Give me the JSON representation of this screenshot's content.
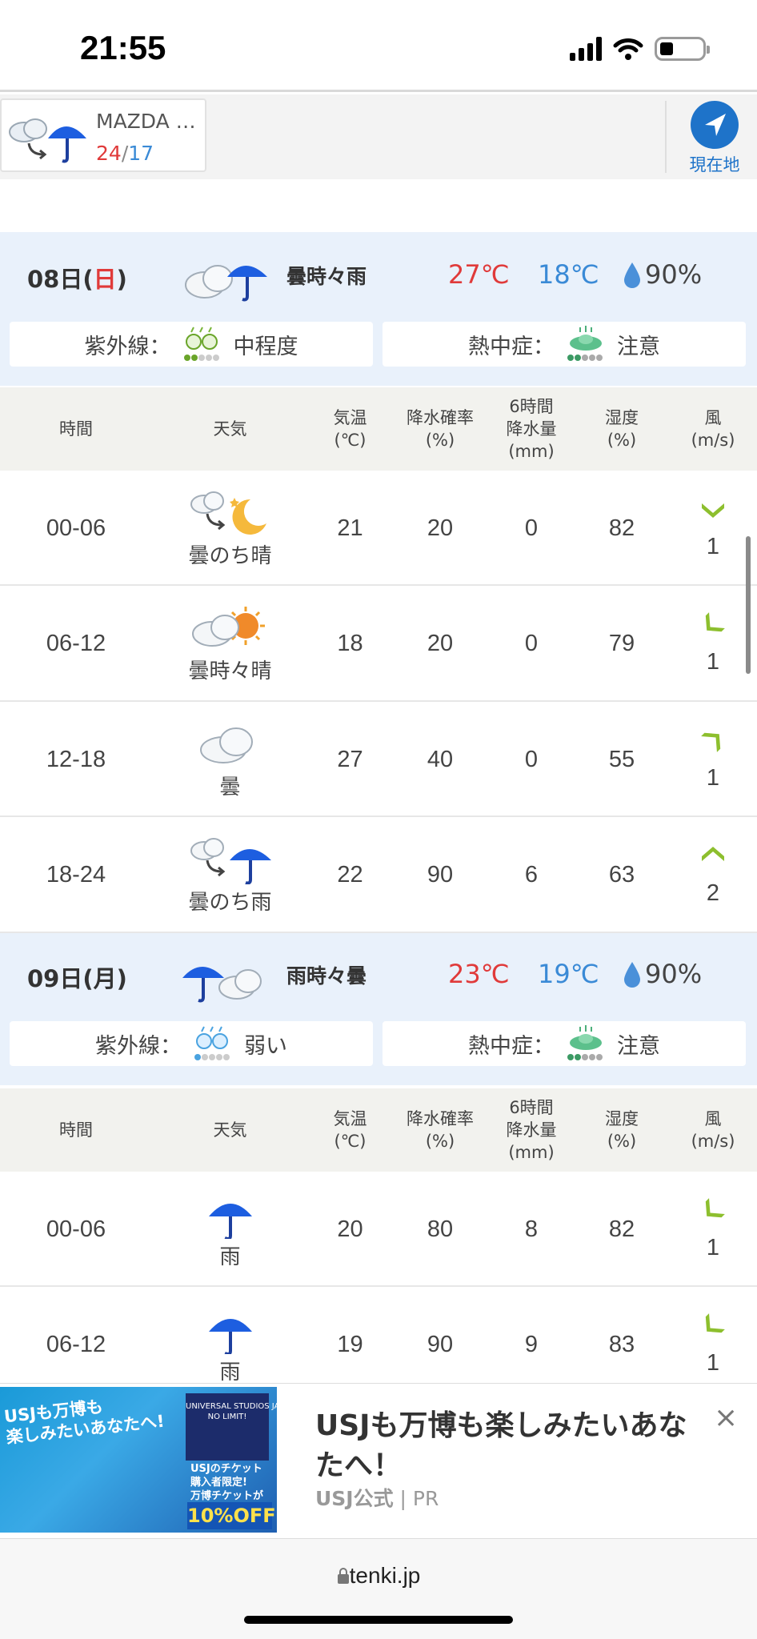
{
  "status": {
    "time": "21:55"
  },
  "location": {
    "name": "MAZDA …",
    "high": "24",
    "sep": "/",
    "low": "17",
    "gps_label": "現在地"
  },
  "days": [
    {
      "date": "08日(",
      "weekday": "日",
      "date_end": ")",
      "weather": "曇時々雨",
      "high": "27℃",
      "low": "18℃",
      "rain": "90%",
      "uv_label": "紫外線：",
      "uv_value": "中程度",
      "heat_label": "熱中症：",
      "heat_value": "注意",
      "header": {
        "time": "時間",
        "weather": "天気",
        "temp": "気温\n(℃)",
        "prob": "降水確率\n(%)",
        "amount": "6時間\n降水量\n(mm)",
        "humidity": "湿度\n(%)",
        "wind": "風\n(m/s)"
      },
      "rows": [
        {
          "time": "00-06",
          "weather": "曇のち晴",
          "icon": "cloud-then-moon-icon",
          "temp": "21",
          "prob": "20",
          "amount": "0",
          "humidity": "82",
          "wind": "1",
          "wind_dir": "south"
        },
        {
          "time": "06-12",
          "weather": "曇時々晴",
          "icon": "cloud-sun-icon",
          "temp": "18",
          "prob": "20",
          "amount": "0",
          "humidity": "79",
          "wind": "1",
          "wind_dir": "southwest"
        },
        {
          "time": "12-18",
          "weather": "曇",
          "icon": "cloud-icon",
          "temp": "27",
          "prob": "40",
          "amount": "0",
          "humidity": "55",
          "wind": "1",
          "wind_dir": "northeast"
        },
        {
          "time": "18-24",
          "weather": "曇のち雨",
          "icon": "cloud-then-rain-icon",
          "temp": "22",
          "prob": "90",
          "amount": "6",
          "humidity": "63",
          "wind": "2",
          "wind_dir": "north"
        }
      ]
    },
    {
      "date": "09日(",
      "weekday": "月",
      "date_end": ")",
      "weather": "雨時々曇",
      "high": "23℃",
      "low": "19℃",
      "rain": "90%",
      "uv_label": "紫外線：",
      "uv_value": "弱い",
      "heat_label": "熱中症：",
      "heat_value": "注意",
      "rows": [
        {
          "time": "00-06",
          "weather": "雨",
          "icon": "umbrella-icon",
          "temp": "20",
          "prob": "80",
          "amount": "8",
          "humidity": "82",
          "wind": "1",
          "wind_dir": "southwest"
        },
        {
          "time": "06-12",
          "weather": "雨",
          "icon": "umbrella-icon",
          "temp": "19",
          "prob": "90",
          "amount": "9",
          "humidity": "83",
          "wind": "1",
          "wind_dir": "southwest"
        }
      ]
    }
  ],
  "ad": {
    "title": "USJも万博も楽しみたいあなたへ！",
    "sponsor": "USJ公式",
    "pr": " | PR",
    "img_text": "USJも万博も\n楽しみたいあなたへ!",
    "badge_top": "UNIVERSAL STUDIOS JAPAN\nNO LIMIT!",
    "badge_mid": "USJのチケット\n購入者限定!\n万博チケットが",
    "badge_off": "10%OFF",
    "close": "×"
  },
  "browser": {
    "url": "tenki.jp"
  },
  "colors": {
    "accent": "#1e73c9",
    "high": "#e03a3a",
    "low": "#3a8ad6",
    "day_bg": "#e9f1fb",
    "wind": "#8dbf2e"
  }
}
